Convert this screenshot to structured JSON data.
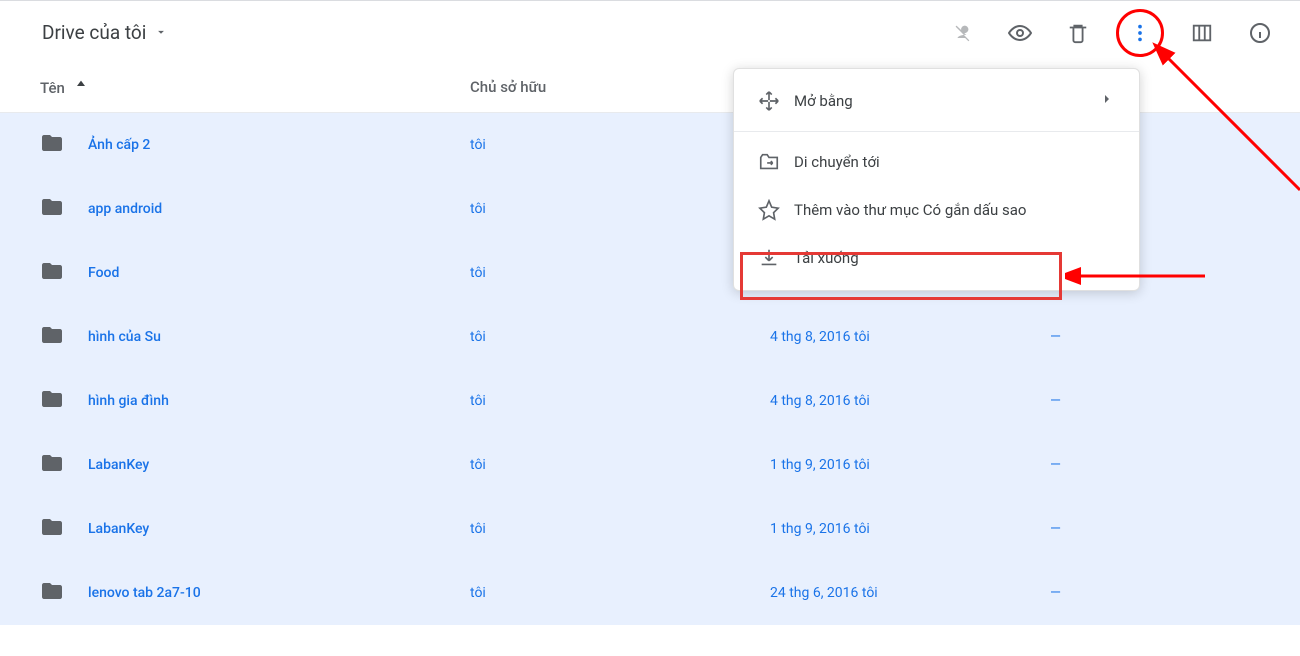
{
  "breadcrumb": {
    "title": "Drive của tôi"
  },
  "toolbar": {
    "share_icon": "share-off",
    "preview_icon": "eye",
    "trash_icon": "trash",
    "more_icon": "more-vert",
    "view_icon": "grid",
    "info_icon": "info"
  },
  "headers": {
    "name": "Tên",
    "owner": "Chủ sở hữu"
  },
  "rows": [
    {
      "name": "Ảnh cấp 2",
      "owner": "tôi",
      "date": "",
      "size": ""
    },
    {
      "name": "app android",
      "owner": "tôi",
      "date": "",
      "size": ""
    },
    {
      "name": "Food",
      "owner": "tôi",
      "date": "",
      "size": ""
    },
    {
      "name": "hình của Su",
      "owner": "tôi",
      "date": "4 thg 8, 2016 tôi",
      "size": "—"
    },
    {
      "name": "hình gia đình",
      "owner": "tôi",
      "date": "4 thg 8, 2016 tôi",
      "size": "—"
    },
    {
      "name": "LabanKey",
      "owner": "tôi",
      "date": "1 thg 9, 2016 tôi",
      "size": "—"
    },
    {
      "name": "LabanKey",
      "owner": "tôi",
      "date": "1 thg 9, 2016 tôi",
      "size": "—"
    },
    {
      "name": "lenovo tab 2a7-10",
      "owner": "tôi",
      "date": "24 thg 6, 2016 tôi",
      "size": "—"
    }
  ],
  "menu": {
    "open_with": "Mở bằng",
    "move_to": "Di chuyển tới",
    "add_star": "Thêm vào thư mục Có gắn dấu sao",
    "download": "Tải xuống"
  }
}
